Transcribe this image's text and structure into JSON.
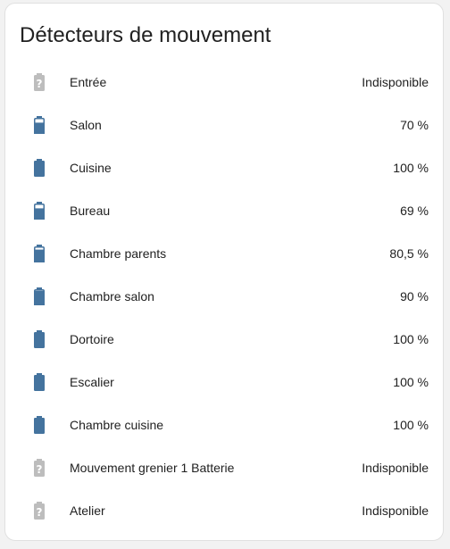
{
  "card": {
    "title": "Détecteurs de mouvement"
  },
  "colors": {
    "battery": "#44739e",
    "unknown": "#bdbdbd"
  },
  "entities": [
    {
      "name": "Entrée",
      "state": "Indisponible",
      "icon": "battery-unknown-icon",
      "level": null
    },
    {
      "name": "Salon",
      "state": "70 %",
      "icon": "battery-70-icon",
      "level": 70
    },
    {
      "name": "Cuisine",
      "state": "100 %",
      "icon": "battery-full-icon",
      "level": 100
    },
    {
      "name": "Bureau",
      "state": "69 %",
      "icon": "battery-60-icon",
      "level": 69
    },
    {
      "name": "Chambre parents",
      "state": "80,5 %",
      "icon": "battery-80-icon",
      "level": 80.5
    },
    {
      "name": "Chambre salon",
      "state": "90 %",
      "icon": "battery-90-icon",
      "level": 90
    },
    {
      "name": "Dortoire",
      "state": "100 %",
      "icon": "battery-full-icon",
      "level": 100
    },
    {
      "name": "Escalier",
      "state": "100 %",
      "icon": "battery-full-icon",
      "level": 100
    },
    {
      "name": "Chambre cuisine",
      "state": "100 %",
      "icon": "battery-full-icon",
      "level": 100
    },
    {
      "name": "Mouvement grenier 1 Batterie",
      "state": "Indisponible",
      "icon": "battery-unknown-icon",
      "level": null
    },
    {
      "name": "Atelier",
      "state": "Indisponible",
      "icon": "battery-unknown-icon",
      "level": null
    }
  ]
}
